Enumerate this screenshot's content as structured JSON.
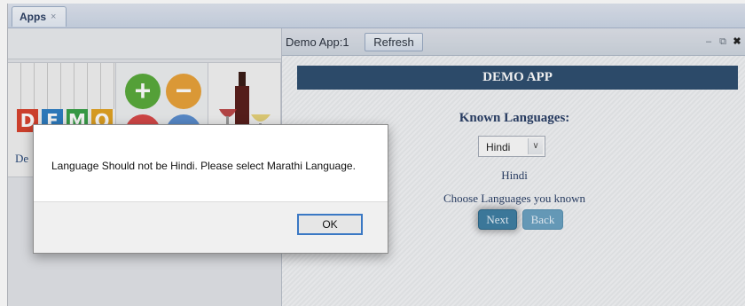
{
  "tabs": [
    {
      "label": "Apps",
      "close": "×"
    }
  ],
  "launcher": {
    "apps": [
      {
        "name": "Demo",
        "label": "De",
        "tile_letters": [
          "D",
          "E",
          "M",
          "O"
        ],
        "tile_colors": [
          "#d8432f",
          "#2f7fc4",
          "#3aa14a",
          "#e2a324"
        ]
      },
      {
        "name": "Calculator",
        "icons": [
          "plus-icon",
          "minus-icon",
          "multiply-icon",
          "divide-icon"
        ],
        "icon_colors": [
          "#5aaa3c",
          "#e8a23a",
          "#d94a4a",
          "#5b8fd0"
        ]
      },
      {
        "name": "Wine",
        "icons": [
          "wine-bottle-icon"
        ]
      }
    ]
  },
  "app_window": {
    "title": "Demo App:1",
    "refresh_label": "Refresh",
    "banner": "DEMO APP",
    "known_languages_label": "Known Languages:",
    "language_select": {
      "value": "Hindi",
      "options": [
        "Hindi"
      ]
    },
    "selected_language_text": "Hindi",
    "choose_text": "Choose Languages you known",
    "next_label": "Next",
    "back_label": "Back"
  },
  "dialog": {
    "message": "Language Should not be Hindi. Please select Marathi Language.",
    "ok_label": "OK"
  },
  "colors": {
    "banner": "#2f4f70",
    "next_button": "#3f7fa3",
    "back_button": "#6ba2c2",
    "ok_focus_border": "#3a78c4"
  }
}
